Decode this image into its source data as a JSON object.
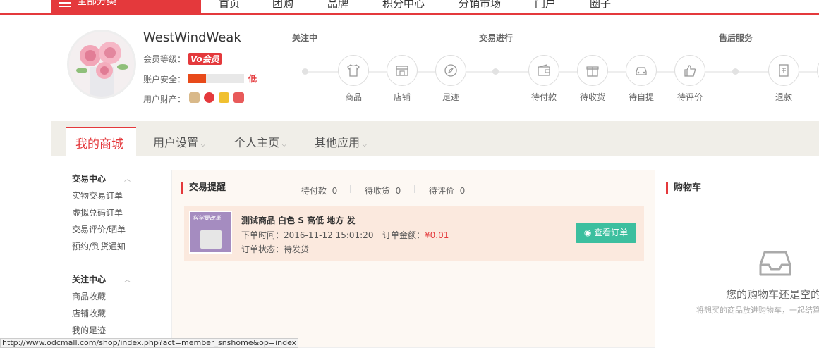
{
  "topnav": {
    "all_categories": "全部分类",
    "links": [
      "首页",
      "团购",
      "品牌",
      "积分中心",
      "分销市场",
      "门户",
      "圈子"
    ]
  },
  "profile": {
    "username": "WestWindWeak",
    "member_level_label": "会员等级：",
    "member_level_badge": "Vo会员",
    "security_label": "账户安全：",
    "security_level": "低",
    "security_fill": 0.33,
    "assets_label": "用户财产："
  },
  "tracker": {
    "sections": [
      "关注中",
      "交易进行",
      "售后服务"
    ],
    "items": [
      {
        "label": "商品",
        "icon": "shirt-icon"
      },
      {
        "label": "店铺",
        "icon": "store-icon"
      },
      {
        "label": "足迹",
        "icon": "compass-icon"
      },
      {
        "label": "待付款",
        "icon": "wallet-icon"
      },
      {
        "label": "待收货",
        "icon": "gift-icon"
      },
      {
        "label": "待自提",
        "icon": "car-icon"
      },
      {
        "label": "待评价",
        "icon": "thumbs-up-icon"
      },
      {
        "label": "退款",
        "icon": "refund-icon"
      }
    ]
  },
  "tabs": {
    "active": "我的商城",
    "others": [
      "用户设置",
      "个人主页",
      "其他应用"
    ]
  },
  "sidebar": {
    "groups": [
      {
        "title": "交易中心",
        "items": [
          "实物交易订单",
          "虚拟兑码订单",
          "交易评价/晒单",
          "预约/到货通知"
        ]
      },
      {
        "title": "关注中心",
        "items": [
          "商品收藏",
          "店铺收藏",
          "我的足迹"
        ]
      }
    ]
  },
  "trade": {
    "title": "交易提醒",
    "stats": [
      {
        "label": "待付款",
        "count": "0"
      },
      {
        "label": "待收货",
        "count": "0"
      },
      {
        "label": "待评价",
        "count": "0"
      }
    ],
    "order": {
      "name": "测试商品 白色 S 高低 地方 发",
      "time": "下单时间：2016-11-12 15:01:20",
      "amount_label": "订单金额：",
      "amount": "¥0.01",
      "status": "订单状态：待发货",
      "thumb_text": "科学要改革",
      "view_button": "查看订单"
    }
  },
  "cart": {
    "title": "购物车",
    "empty_text": "您的购物车还是空的",
    "hint": "将想买的商品放进购物车，一起结算"
  },
  "statusbar": {
    "url": "http://www.odcmall.com/shop/index.php?act=member_snshome&op=index"
  },
  "colors": {
    "accent": "#e4393c",
    "button": "#3cbf9f",
    "tab_bar": "#f0eee8"
  }
}
